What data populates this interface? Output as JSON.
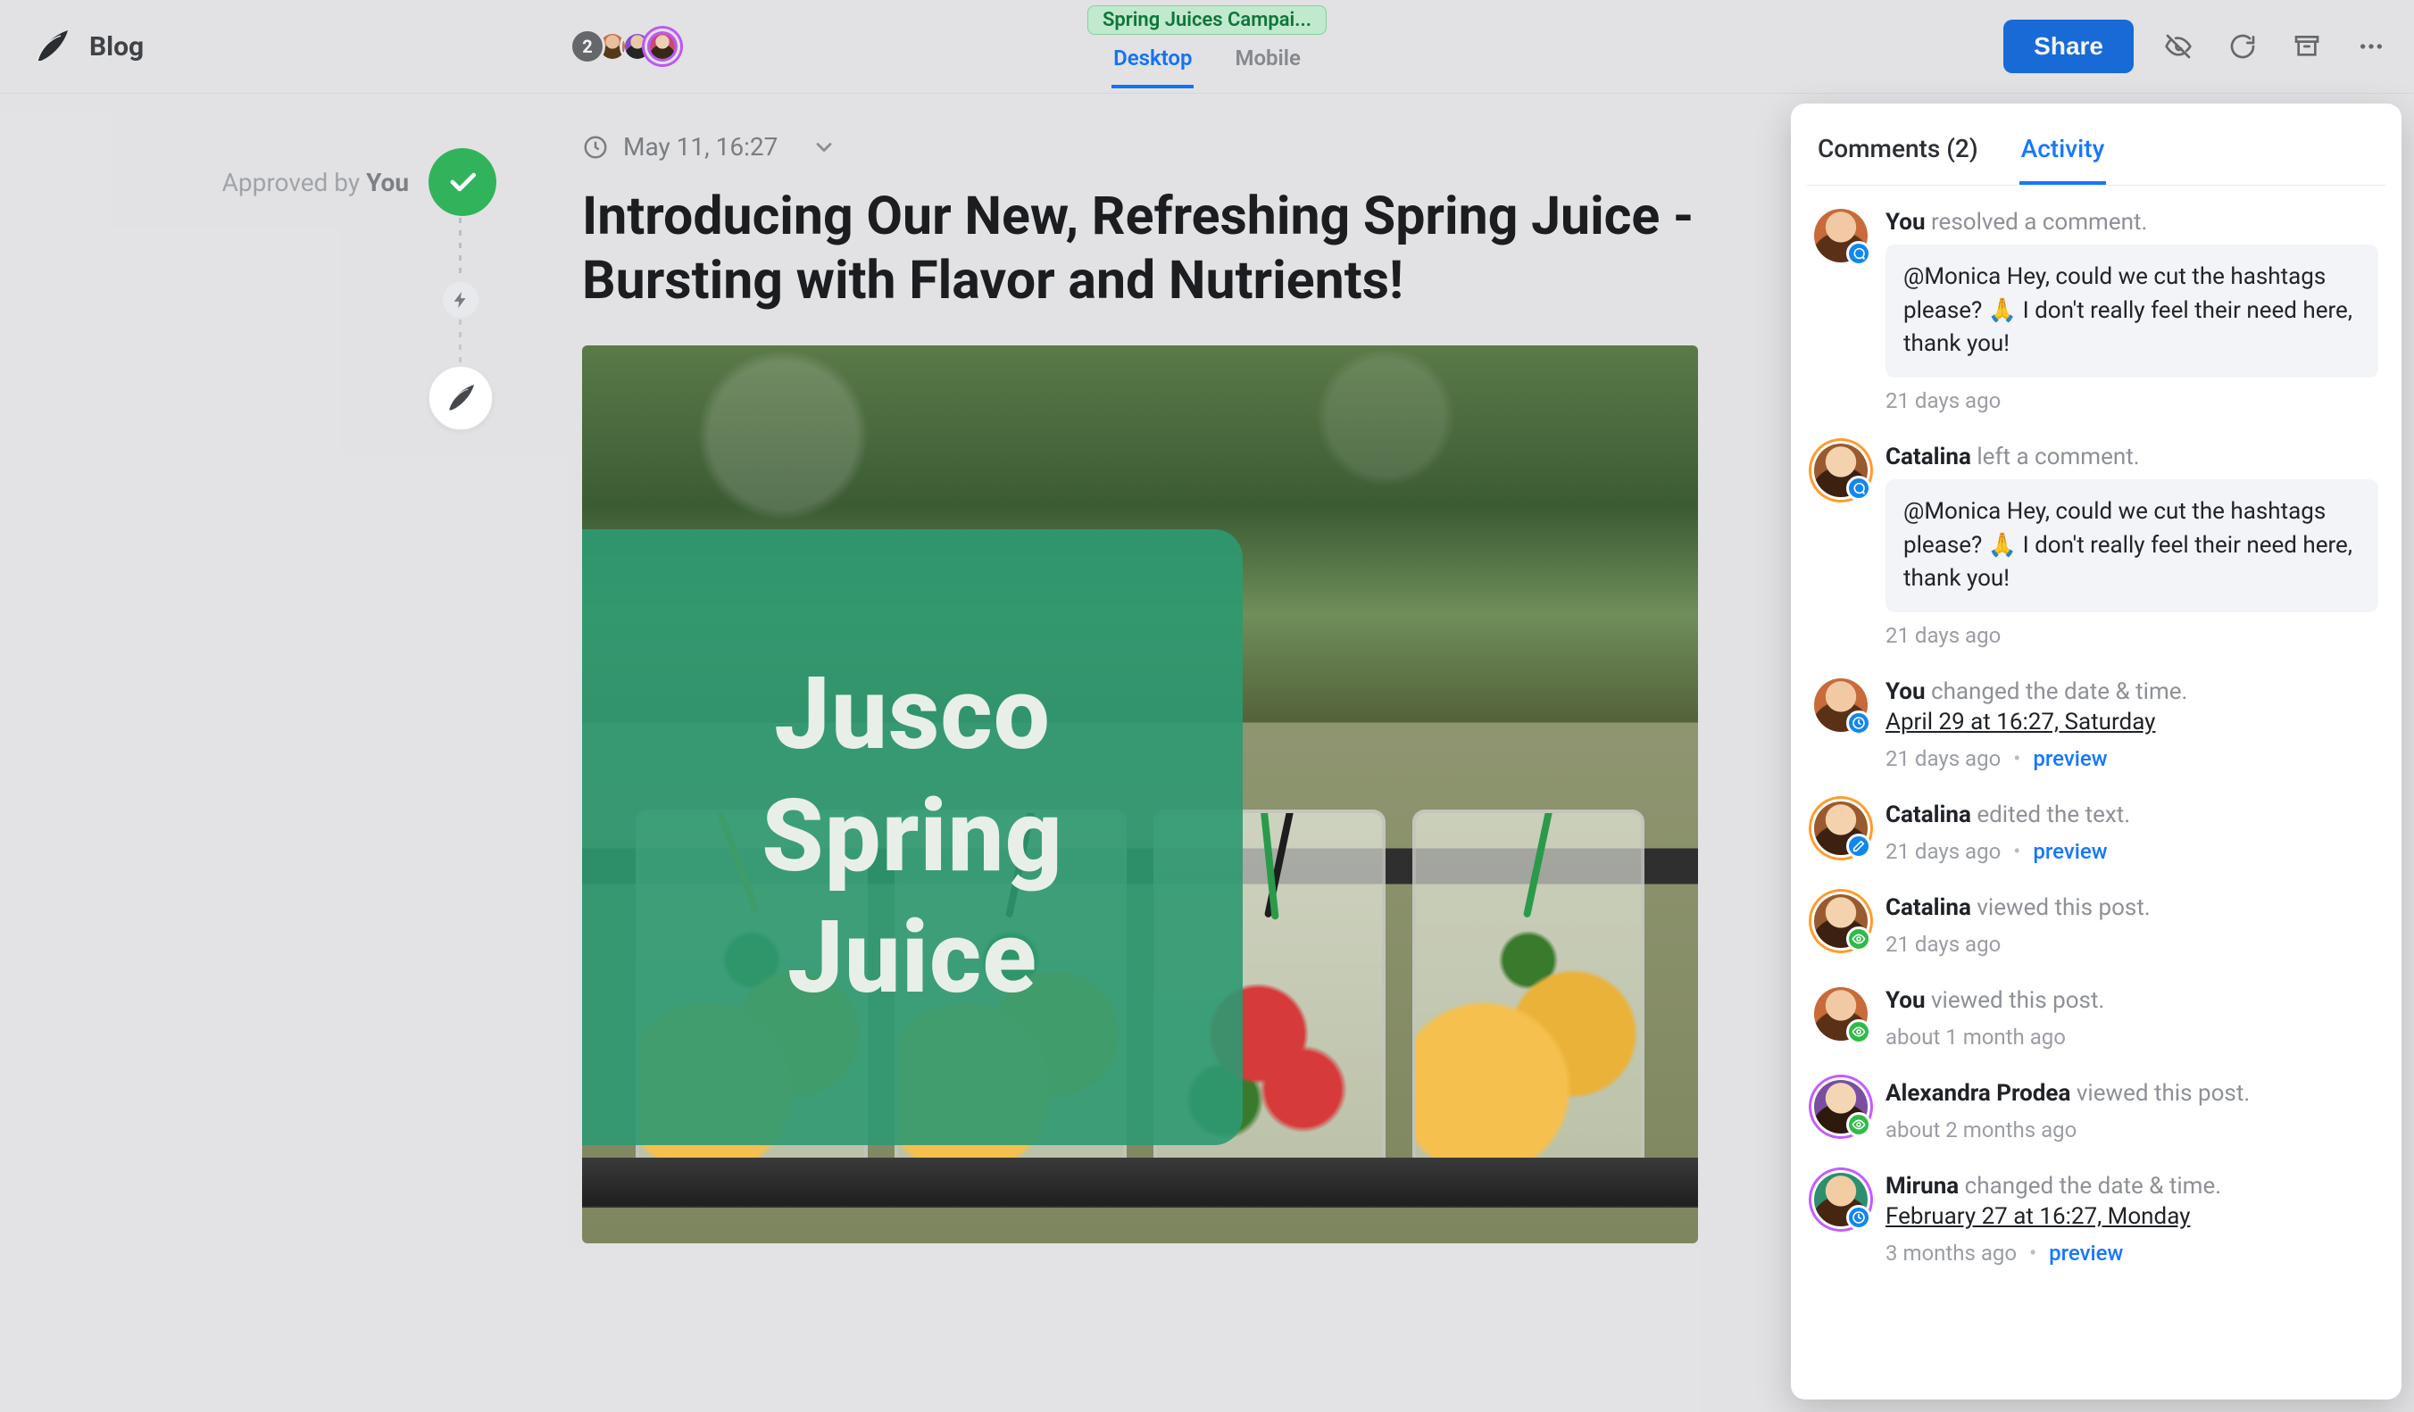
{
  "header": {
    "app_label": "Blog",
    "collaborators_count": "2",
    "campaign_chip": "Spring Juices Campai...",
    "view_tabs": {
      "desktop": "Desktop",
      "mobile": "Mobile"
    },
    "share_label": "Share"
  },
  "status": {
    "approved_prefix": "Approved by ",
    "approved_by": "You"
  },
  "post": {
    "timestamp": "May 11, 16:27",
    "title": "Introducing Our New, Refreshing Spring Juice - Bursting with Flavor and Nutrients!",
    "overlay_line1": "Jusco",
    "overlay_line2": "Spring",
    "overlay_line3": "Juice"
  },
  "panel": {
    "comments_tab": "Comments (2)",
    "activity_tab": "Activity"
  },
  "activity": [
    {
      "actor": "You",
      "action": "resolved a comment.",
      "comment": "@Monica Hey, could we cut the hashtags please? 🙏 I don't really feel their need here, thank you!",
      "time": "21 days ago",
      "badge": "comment",
      "face": "f-you"
    },
    {
      "actor": "Catalina",
      "action": "left a comment.",
      "comment": "@Monica Hey, could we cut the hashtags please? 🙏 I don't really feel their need here, thank you!",
      "time": "21 days ago",
      "badge": "comment",
      "face": "f-cat",
      "ring": "orange"
    },
    {
      "actor": "You",
      "action": "changed the date & time.",
      "date_link": "April 29 at 16:27, Saturday",
      "time": "21 days ago",
      "preview": "preview",
      "badge": "clock",
      "face": "f-you"
    },
    {
      "actor": "Catalina",
      "action": "edited the text.",
      "time": "21 days ago",
      "preview": "preview",
      "badge": "edit",
      "face": "f-cat",
      "ring": "orange"
    },
    {
      "actor": "Catalina",
      "action": "viewed this post.",
      "time": "21 days ago",
      "badge": "eye",
      "face": "f-cat",
      "ring": "orange"
    },
    {
      "actor": "You",
      "action": "viewed this post.",
      "time": "about 1 month ago",
      "badge": "eye",
      "face": "f-you"
    },
    {
      "actor": "Alexandra Prodea",
      "action": "viewed this post.",
      "time": "about 2 months ago",
      "badge": "eye",
      "face": "f-alex",
      "ring": "purple"
    },
    {
      "actor": "Miruna",
      "action": "changed the date & time.",
      "date_link": "February 27 at 16:27, Monday",
      "time": "3 months ago",
      "preview": "preview",
      "badge": "clock",
      "face": "f-mir",
      "ring": "purple"
    }
  ]
}
